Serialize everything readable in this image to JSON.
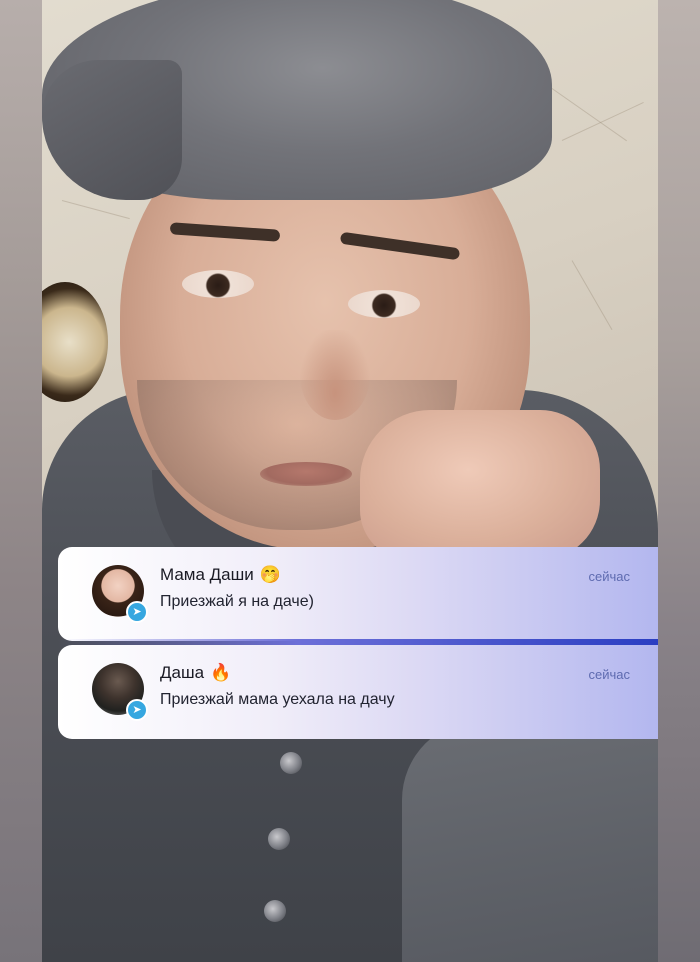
{
  "notifications": [
    {
      "sender": "Мама Даши",
      "sender_emoji": "🤭",
      "message": "Приезжай я на даче)",
      "time": "сейчас",
      "app_icon": "telegram-icon"
    },
    {
      "sender": "Даша",
      "sender_emoji": "🔥",
      "message": "Приезжай мама уехала на дачу",
      "time": "сейчас",
      "app_icon": "telegram-icon"
    }
  ],
  "colors": {
    "notification_gradient_end": "#b3b7ef",
    "time_text": "#5e6bb0",
    "telegram_badge": "#36a7e0"
  }
}
